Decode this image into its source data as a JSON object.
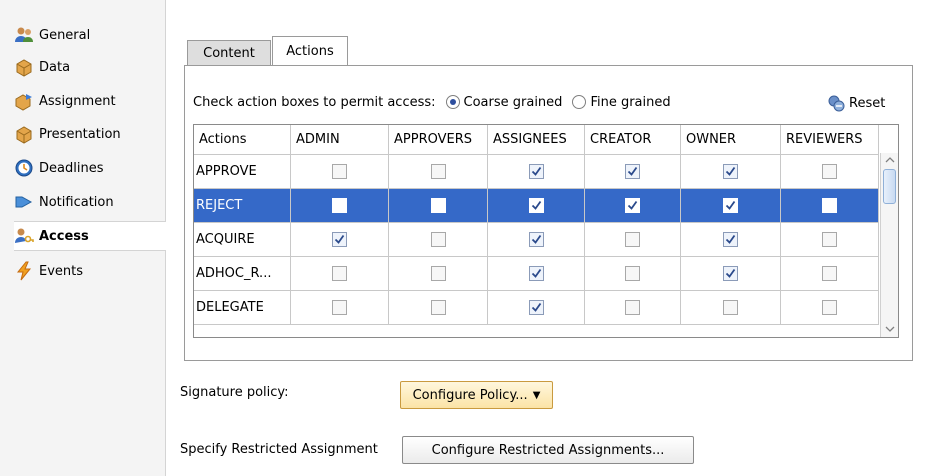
{
  "nav": {
    "items": [
      {
        "label": "General",
        "icon": "users-icon"
      },
      {
        "label": "Data",
        "icon": "data-icon"
      },
      {
        "label": "Assignment",
        "icon": "assignment-icon"
      },
      {
        "label": "Presentation",
        "icon": "presentation-icon"
      },
      {
        "label": "Deadlines",
        "icon": "clock-icon"
      },
      {
        "label": "Notification",
        "icon": "notification-icon"
      },
      {
        "label": "Access",
        "icon": "key-user-icon",
        "active": true
      },
      {
        "label": "Events",
        "icon": "lightning-icon"
      }
    ]
  },
  "tabs": [
    {
      "label": "Content",
      "selected": false
    },
    {
      "label": "Actions",
      "selected": true
    }
  ],
  "access": {
    "prompt": "Check action boxes to permit access:",
    "options": [
      {
        "label": "Coarse grained",
        "selected": true
      },
      {
        "label": "Fine grained",
        "selected": false
      }
    ],
    "reset_label": "Reset"
  },
  "table": {
    "columns": [
      "Actions",
      "ADMIN",
      "APPROVERS",
      "ASSIGNEES",
      "CREATOR",
      "OWNER",
      "REVIEWERS"
    ],
    "rows": [
      {
        "action": "APPROVE",
        "checks": [
          false,
          false,
          true,
          true,
          true,
          false
        ],
        "selected": false
      },
      {
        "action": "REJECT",
        "checks": [
          false,
          false,
          true,
          true,
          true,
          false
        ],
        "selected": true
      },
      {
        "action": "ACQUIRE",
        "checks": [
          true,
          false,
          true,
          false,
          true,
          false
        ],
        "selected": false
      },
      {
        "action": "ADHOC_R...",
        "checks": [
          false,
          false,
          true,
          false,
          true,
          false
        ],
        "selected": false
      },
      {
        "action": "DELEGATE",
        "checks": [
          false,
          false,
          true,
          false,
          false,
          false
        ],
        "selected": false
      }
    ]
  },
  "form": {
    "signature_label": "Signature policy:",
    "signature_button": "Configure Policy...",
    "restricted_label": "Specify Restricted Assignment",
    "restricted_button": "Configure Restricted Assignments..."
  },
  "colors": {
    "selection": "#3569c8",
    "policy_button": "#fbe3a6"
  }
}
